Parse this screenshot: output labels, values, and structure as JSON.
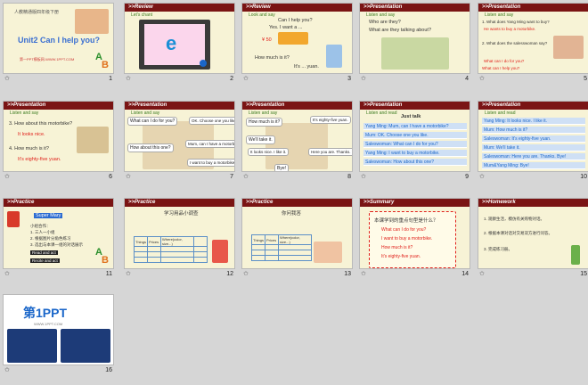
{
  "slides": [
    {
      "num": "1",
      "banner": "",
      "lines": [
        "人教精通版四年级下册",
        "Unit2 Can I help you?",
        "第一PPT模板网-WWW.1PPT.COM"
      ]
    },
    {
      "num": "2",
      "banner": ">>Review",
      "sub": "Let's chant",
      "lines": [
        "e"
      ]
    },
    {
      "num": "3",
      "banner": ">>Review",
      "sub": "Look and say",
      "lines": [
        "Can I help you?",
        "Yes. I want a ...",
        "¥ 50",
        "How much is it?",
        "It's ... yuan."
      ]
    },
    {
      "num": "4",
      "banner": ">>Presentation",
      "sub": "Listen and say",
      "lines": [
        "Who are they?",
        "What are they talking about?"
      ]
    },
    {
      "num": "5",
      "banner": ">>Presentation",
      "sub": "Listen and say",
      "lines": [
        "1. What does Yang Ming want to buy?",
        "He wants to buy a motorbike.",
        "2. What does the salesswoman say?",
        "What can I do for you?",
        "What can I help you?"
      ]
    },
    {
      "num": "6",
      "banner": ">>Presentation",
      "sub": "Listen and say",
      "lines": [
        "3. How about this motorbike?",
        "It looks nice.",
        "4. How much is it?",
        "It's eighty-five yuan."
      ]
    },
    {
      "num": "7",
      "banner": ">>Presentation",
      "sub": "Listen and say",
      "lines": [
        "What can I do for you?",
        "OK. Choose one you like.",
        "How about this one?",
        "Mum, can I have a motorbike?",
        "I want to buy a motorbike."
      ]
    },
    {
      "num": "8",
      "banner": ">>Presentation",
      "sub": "Listen and say",
      "lines": [
        "How much is it?",
        "It's eighty-five yuan.",
        "We'll take it.",
        "It looks nice. I like it.",
        "Here you are. Thanks. Bye!",
        "Bye!"
      ]
    },
    {
      "num": "9",
      "banner": ">>Presentation",
      "sub": "Listen and read",
      "lines": [
        "Just talk",
        "Yang Ming: Mum, can I have a motorbike?",
        "Mum: OK. Choose one you like.",
        "Saleswoman: What can I do for you?",
        "Yang Ming: I want to buy a motorbike.",
        "Saleswoman: How about this one?"
      ]
    },
    {
      "num": "10",
      "banner": ">>Presentation",
      "sub": "Listen and read",
      "lines": [
        "Yang Ming: It looks nice. I like it.",
        "Mum: How much is it?",
        "Saleswoman: It's eighty-five yuan.",
        "Mum: We'll take it.",
        "Saleswoman: Here you are. Thanks. Bye!",
        "Mum&Yang Ming: Bye!"
      ]
    },
    {
      "num": "11",
      "banner": ">>Practice",
      "lines": [
        "Super Mary",
        "小组合作：",
        "1. 三人一小组",
        "2. 根据图片分角色练习",
        "3. 选出与本课一组的对话展示",
        "Read and act",
        "Recite and act"
      ]
    },
    {
      "num": "12",
      "banner": ">>Practice",
      "lines": [
        "学习用品小调查",
        "Things",
        "Prices",
        "Where(color, size...)"
      ]
    },
    {
      "num": "13",
      "banner": ">>Practice",
      "lines": [
        "你问我答",
        "Things",
        "Prices",
        "Where(color, size...)"
      ]
    },
    {
      "num": "14",
      "banner": ">>Summary",
      "lines": [
        "本课学到的重点句型是什么？",
        "What can I do for you?",
        "I want to buy a motorbike.",
        "How much is it?",
        "It's eighty-five yuan."
      ]
    },
    {
      "num": "15",
      "banner": ">>Homework",
      "lines": [
        "1. 观察生活，模仿有关购物对话。",
        "2. 根据本课对话对交易双方进行问答。",
        "3. 完成练习册。"
      ]
    },
    {
      "num": "16",
      "banner": "",
      "lines": [
        "第1PPT",
        "WWW.1PPT.COM"
      ]
    }
  ],
  "colors": {
    "bg": "#d6d6d6",
    "slide": "#f7f3d6",
    "banner": "#7a1414",
    "red": "#e0201a",
    "blue": "#1a66c9"
  }
}
